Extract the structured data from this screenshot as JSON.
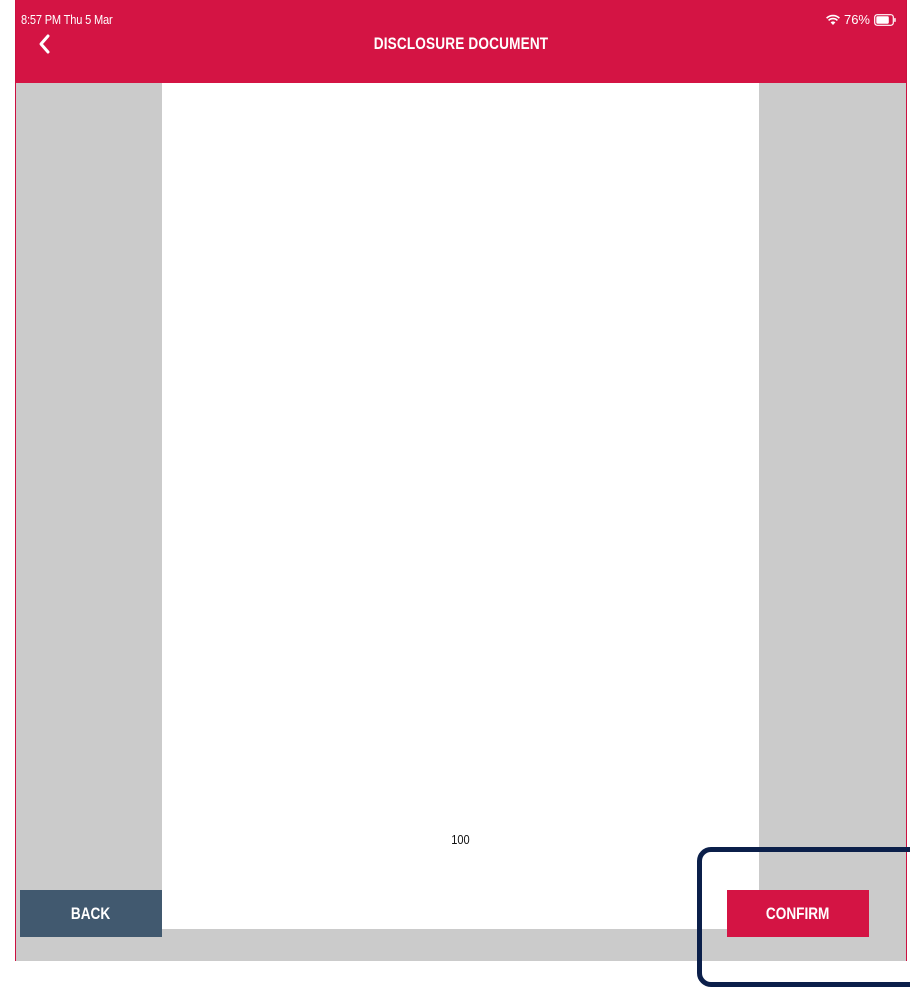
{
  "status_bar": {
    "time": "8:57 PM  Thu 5 Mar",
    "battery": "76%"
  },
  "header": {
    "title": "DISCLOSURE DOCUMENT",
    "back_icon": "chevron-left-icon"
  },
  "document": {
    "page_number": "100"
  },
  "footer": {
    "back_label": "BACK",
    "confirm_label": "CONFIRM"
  },
  "colors": {
    "brand_red": "#d41444",
    "back_button": "#41596f",
    "viewer_background": "#cbcbcb",
    "highlight": "#0b1f4a"
  }
}
